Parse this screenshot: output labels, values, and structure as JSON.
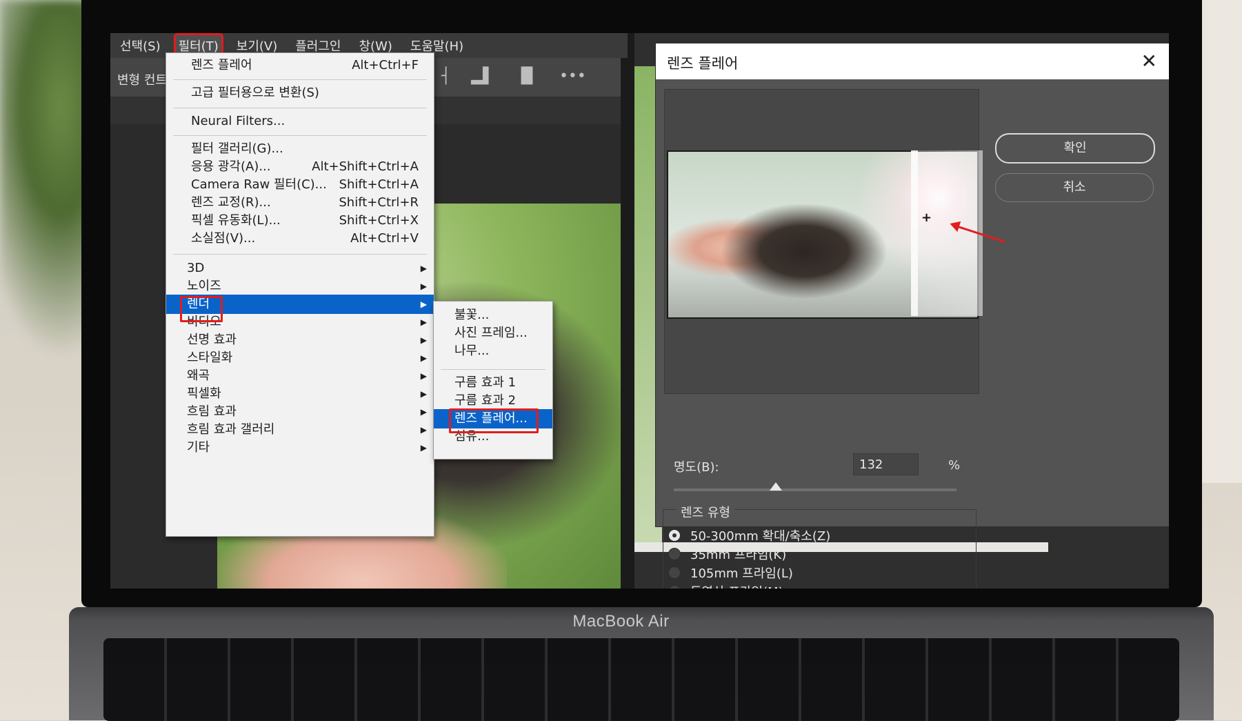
{
  "laptop": {
    "brand": "MacBook Air"
  },
  "left_window": {
    "menubar": [
      {
        "label": "선택(S)",
        "active": false
      },
      {
        "label": "필터(T)",
        "active": true
      },
      {
        "label": "보기(V)",
        "active": false
      },
      {
        "label": "플러그인",
        "active": false
      },
      {
        "label": "창(W)",
        "active": false
      },
      {
        "label": "도움말(H)",
        "active": false
      }
    ],
    "options_label": "변형 컨트",
    "filter_menu": {
      "items": [
        {
          "label": "렌즈 플레어",
          "shortcut": "Alt+Ctrl+F"
        },
        {
          "label": "고급 필터용으로 변환(S)",
          "shortcut": ""
        },
        {
          "label": "Neural Filters...",
          "shortcut": ""
        },
        {
          "label": "필터 갤러리(G)...",
          "shortcut": ""
        },
        {
          "label": "응용 광각(A)...",
          "shortcut": "Alt+Shift+Ctrl+A"
        },
        {
          "label": "Camera Raw 필터(C)...",
          "shortcut": "Shift+Ctrl+A"
        },
        {
          "label": "렌즈 교정(R)...",
          "shortcut": "Shift+Ctrl+R"
        },
        {
          "label": "픽셀 유동화(L)...",
          "shortcut": "Shift+Ctrl+X"
        },
        {
          "label": "소실점(V)...",
          "shortcut": "Alt+Ctrl+V"
        },
        {
          "label": "3D",
          "shortcut": ""
        },
        {
          "label": "노이즈",
          "shortcut": ""
        },
        {
          "label": "렌더",
          "shortcut": ""
        },
        {
          "label": "비디오",
          "shortcut": ""
        },
        {
          "label": "선명 효과",
          "shortcut": ""
        },
        {
          "label": "스타일화",
          "shortcut": ""
        },
        {
          "label": "왜곡",
          "shortcut": ""
        },
        {
          "label": "픽셀화",
          "shortcut": ""
        },
        {
          "label": "흐림 효과",
          "shortcut": ""
        },
        {
          "label": "흐림 효과 갤러리",
          "shortcut": ""
        },
        {
          "label": "기타",
          "shortcut": ""
        }
      ],
      "highlighted": "렌더"
    },
    "render_submenu": {
      "items": [
        "불꽃...",
        "사진 프레임...",
        "나무...",
        "구름 효과 1",
        "구름 효과 2",
        "렌즈 플레어...",
        "섬유..."
      ],
      "highlighted": "렌즈 플레어..."
    }
  },
  "lens_flare_dialog": {
    "title": "렌즈 플레어",
    "close_symbol": "✕",
    "ok_label": "확인",
    "cancel_label": "취소",
    "brightness_label": "명도(B):",
    "brightness_value": "132",
    "brightness_unit": "%",
    "brightness_slider_fraction": 0.36,
    "lens_type_label": "렌즈 유형",
    "lens_types": [
      {
        "label": "50-300mm 확대/축소(Z)",
        "selected": true
      },
      {
        "label": "35mm 프라임(K)",
        "selected": false
      },
      {
        "label": "105mm 프라임(L)",
        "selected": false
      },
      {
        "label": "동영상 프라임(M)",
        "selected": false
      }
    ]
  },
  "colors": {
    "highlight_blue": "#0a63c9",
    "annotation_red": "#e11d1d"
  }
}
